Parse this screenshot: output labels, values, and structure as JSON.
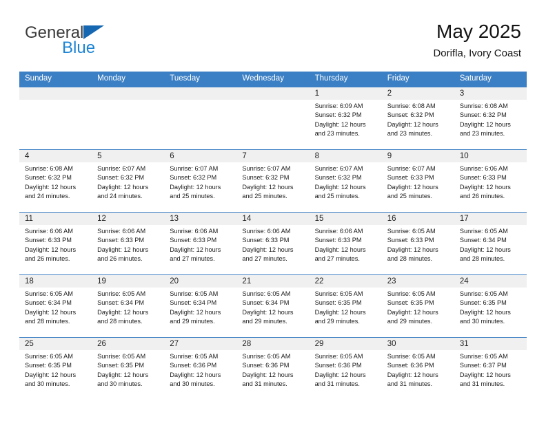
{
  "brand": {
    "line1": "General",
    "line2": "Blue",
    "logo_icon": "triangle-logo-icon"
  },
  "header": {
    "title": "May 2025",
    "subtitle": "Dorifla, Ivory Coast"
  },
  "theme": {
    "header_blue": "#3b7fc4",
    "brand_blue": "#1d84d4",
    "logo_blue": "#1667b1",
    "daynum_band": "#f0f0f0"
  },
  "weekdays": [
    "Sunday",
    "Monday",
    "Tuesday",
    "Wednesday",
    "Thursday",
    "Friday",
    "Saturday"
  ],
  "weeks": [
    [
      {
        "day": "",
        "empty": true
      },
      {
        "day": "",
        "empty": true
      },
      {
        "day": "",
        "empty": true
      },
      {
        "day": "",
        "empty": true
      },
      {
        "day": "1",
        "sunrise": "Sunrise: 6:09 AM",
        "sunset": "Sunset: 6:32 PM",
        "daylight1": "Daylight: 12 hours",
        "daylight2": "and 23 minutes."
      },
      {
        "day": "2",
        "sunrise": "Sunrise: 6:08 AM",
        "sunset": "Sunset: 6:32 PM",
        "daylight1": "Daylight: 12 hours",
        "daylight2": "and 23 minutes."
      },
      {
        "day": "3",
        "sunrise": "Sunrise: 6:08 AM",
        "sunset": "Sunset: 6:32 PM",
        "daylight1": "Daylight: 12 hours",
        "daylight2": "and 23 minutes."
      }
    ],
    [
      {
        "day": "4",
        "sunrise": "Sunrise: 6:08 AM",
        "sunset": "Sunset: 6:32 PM",
        "daylight1": "Daylight: 12 hours",
        "daylight2": "and 24 minutes."
      },
      {
        "day": "5",
        "sunrise": "Sunrise: 6:07 AM",
        "sunset": "Sunset: 6:32 PM",
        "daylight1": "Daylight: 12 hours",
        "daylight2": "and 24 minutes."
      },
      {
        "day": "6",
        "sunrise": "Sunrise: 6:07 AM",
        "sunset": "Sunset: 6:32 PM",
        "daylight1": "Daylight: 12 hours",
        "daylight2": "and 25 minutes."
      },
      {
        "day": "7",
        "sunrise": "Sunrise: 6:07 AM",
        "sunset": "Sunset: 6:32 PM",
        "daylight1": "Daylight: 12 hours",
        "daylight2": "and 25 minutes."
      },
      {
        "day": "8",
        "sunrise": "Sunrise: 6:07 AM",
        "sunset": "Sunset: 6:32 PM",
        "daylight1": "Daylight: 12 hours",
        "daylight2": "and 25 minutes."
      },
      {
        "day": "9",
        "sunrise": "Sunrise: 6:07 AM",
        "sunset": "Sunset: 6:33 PM",
        "daylight1": "Daylight: 12 hours",
        "daylight2": "and 25 minutes."
      },
      {
        "day": "10",
        "sunrise": "Sunrise: 6:06 AM",
        "sunset": "Sunset: 6:33 PM",
        "daylight1": "Daylight: 12 hours",
        "daylight2": "and 26 minutes."
      }
    ],
    [
      {
        "day": "11",
        "sunrise": "Sunrise: 6:06 AM",
        "sunset": "Sunset: 6:33 PM",
        "daylight1": "Daylight: 12 hours",
        "daylight2": "and 26 minutes."
      },
      {
        "day": "12",
        "sunrise": "Sunrise: 6:06 AM",
        "sunset": "Sunset: 6:33 PM",
        "daylight1": "Daylight: 12 hours",
        "daylight2": "and 26 minutes."
      },
      {
        "day": "13",
        "sunrise": "Sunrise: 6:06 AM",
        "sunset": "Sunset: 6:33 PM",
        "daylight1": "Daylight: 12 hours",
        "daylight2": "and 27 minutes."
      },
      {
        "day": "14",
        "sunrise": "Sunrise: 6:06 AM",
        "sunset": "Sunset: 6:33 PM",
        "daylight1": "Daylight: 12 hours",
        "daylight2": "and 27 minutes."
      },
      {
        "day": "15",
        "sunrise": "Sunrise: 6:06 AM",
        "sunset": "Sunset: 6:33 PM",
        "daylight1": "Daylight: 12 hours",
        "daylight2": "and 27 minutes."
      },
      {
        "day": "16",
        "sunrise": "Sunrise: 6:05 AM",
        "sunset": "Sunset: 6:33 PM",
        "daylight1": "Daylight: 12 hours",
        "daylight2": "and 28 minutes."
      },
      {
        "day": "17",
        "sunrise": "Sunrise: 6:05 AM",
        "sunset": "Sunset: 6:34 PM",
        "daylight1": "Daylight: 12 hours",
        "daylight2": "and 28 minutes."
      }
    ],
    [
      {
        "day": "18",
        "sunrise": "Sunrise: 6:05 AM",
        "sunset": "Sunset: 6:34 PM",
        "daylight1": "Daylight: 12 hours",
        "daylight2": "and 28 minutes."
      },
      {
        "day": "19",
        "sunrise": "Sunrise: 6:05 AM",
        "sunset": "Sunset: 6:34 PM",
        "daylight1": "Daylight: 12 hours",
        "daylight2": "and 28 minutes."
      },
      {
        "day": "20",
        "sunrise": "Sunrise: 6:05 AM",
        "sunset": "Sunset: 6:34 PM",
        "daylight1": "Daylight: 12 hours",
        "daylight2": "and 29 minutes."
      },
      {
        "day": "21",
        "sunrise": "Sunrise: 6:05 AM",
        "sunset": "Sunset: 6:34 PM",
        "daylight1": "Daylight: 12 hours",
        "daylight2": "and 29 minutes."
      },
      {
        "day": "22",
        "sunrise": "Sunrise: 6:05 AM",
        "sunset": "Sunset: 6:35 PM",
        "daylight1": "Daylight: 12 hours",
        "daylight2": "and 29 minutes."
      },
      {
        "day": "23",
        "sunrise": "Sunrise: 6:05 AM",
        "sunset": "Sunset: 6:35 PM",
        "daylight1": "Daylight: 12 hours",
        "daylight2": "and 29 minutes."
      },
      {
        "day": "24",
        "sunrise": "Sunrise: 6:05 AM",
        "sunset": "Sunset: 6:35 PM",
        "daylight1": "Daylight: 12 hours",
        "daylight2": "and 30 minutes."
      }
    ],
    [
      {
        "day": "25",
        "sunrise": "Sunrise: 6:05 AM",
        "sunset": "Sunset: 6:35 PM",
        "daylight1": "Daylight: 12 hours",
        "daylight2": "and 30 minutes."
      },
      {
        "day": "26",
        "sunrise": "Sunrise: 6:05 AM",
        "sunset": "Sunset: 6:35 PM",
        "daylight1": "Daylight: 12 hours",
        "daylight2": "and 30 minutes."
      },
      {
        "day": "27",
        "sunrise": "Sunrise: 6:05 AM",
        "sunset": "Sunset: 6:36 PM",
        "daylight1": "Daylight: 12 hours",
        "daylight2": "and 30 minutes."
      },
      {
        "day": "28",
        "sunrise": "Sunrise: 6:05 AM",
        "sunset": "Sunset: 6:36 PM",
        "daylight1": "Daylight: 12 hours",
        "daylight2": "and 31 minutes."
      },
      {
        "day": "29",
        "sunrise": "Sunrise: 6:05 AM",
        "sunset": "Sunset: 6:36 PM",
        "daylight1": "Daylight: 12 hours",
        "daylight2": "and 31 minutes."
      },
      {
        "day": "30",
        "sunrise": "Sunrise: 6:05 AM",
        "sunset": "Sunset: 6:36 PM",
        "daylight1": "Daylight: 12 hours",
        "daylight2": "and 31 minutes."
      },
      {
        "day": "31",
        "sunrise": "Sunrise: 6:05 AM",
        "sunset": "Sunset: 6:37 PM",
        "daylight1": "Daylight: 12 hours",
        "daylight2": "and 31 minutes."
      }
    ]
  ]
}
